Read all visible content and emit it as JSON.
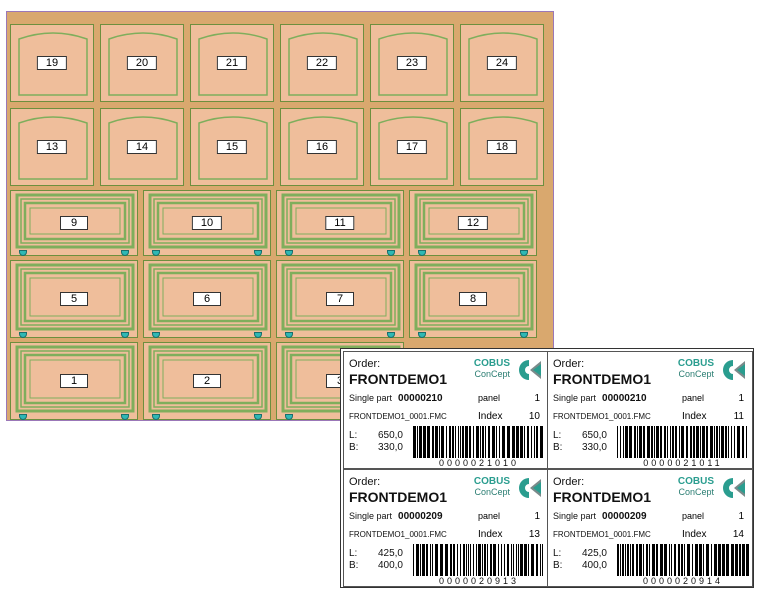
{
  "board": {
    "rows": [
      {
        "style": "arch",
        "panels": [
          "19",
          "20",
          "21",
          "22",
          "23",
          "24"
        ]
      },
      {
        "style": "arch",
        "panels": [
          "13",
          "14",
          "15",
          "16",
          "17",
          "18"
        ]
      },
      {
        "style": "frame",
        "panels": [
          "9",
          "10",
          "11",
          "12"
        ]
      },
      {
        "style": "frame",
        "panels": [
          "5",
          "6",
          "7",
          "8"
        ]
      },
      {
        "style": "frame",
        "panels": [
          "1",
          "2",
          "3"
        ]
      }
    ],
    "colors": {
      "background": "#d9a86e",
      "panel": "#efbe9b",
      "outline": "#6d8f3e",
      "frame": "#7fae5c",
      "hinge": "#2fb8b4"
    }
  },
  "labels": [
    {
      "order_label": "Order:",
      "order_name": "FRONTDEMO1",
      "brand": "COBUS",
      "brand_sub": "ConCept",
      "single_part_label": "Single part",
      "single_part": "00000210",
      "panel_label": "panel",
      "panel_count": "1",
      "file": "FRONTDEMO1_0001.FMC",
      "index_label": "Index",
      "index": "10",
      "l_label": "L:",
      "l_value": "650,0",
      "b_label": "B:",
      "b_value": "330,0",
      "barcode": "0000021010"
    },
    {
      "order_label": "Order:",
      "order_name": "FRONTDEMO1",
      "brand": "COBUS",
      "brand_sub": "ConCept",
      "single_part_label": "Single part",
      "single_part": "00000210",
      "panel_label": "panel",
      "panel_count": "1",
      "file": "FRONTDEMO1_0001.FMC",
      "index_label": "Index",
      "index": "11",
      "l_label": "L:",
      "l_value": "650,0",
      "b_label": "B:",
      "b_value": "330,0",
      "barcode": "0000021011"
    },
    {
      "order_label": "Order:",
      "order_name": "FRONTDEMO1",
      "brand": "COBUS",
      "brand_sub": "ConCept",
      "single_part_label": "Single part",
      "single_part": "00000209",
      "panel_label": "panel",
      "panel_count": "1",
      "file": "FRONTDEMO1_0001.FMC",
      "index_label": "Index",
      "index": "13",
      "l_label": "L:",
      "l_value": "425,0",
      "b_label": "B:",
      "b_value": "400,0",
      "barcode": "0000020913"
    },
    {
      "order_label": "Order:",
      "order_name": "FRONTDEMO1",
      "brand": "COBUS",
      "brand_sub": "ConCept",
      "single_part_label": "Single part",
      "single_part": "00000209",
      "panel_label": "panel",
      "panel_count": "1",
      "file": "FRONTDEMO1_0001.FMC",
      "index_label": "Index",
      "index": "14",
      "l_label": "L:",
      "l_value": "425,0",
      "b_label": "B:",
      "b_value": "400,0",
      "barcode": "0000020914"
    }
  ]
}
